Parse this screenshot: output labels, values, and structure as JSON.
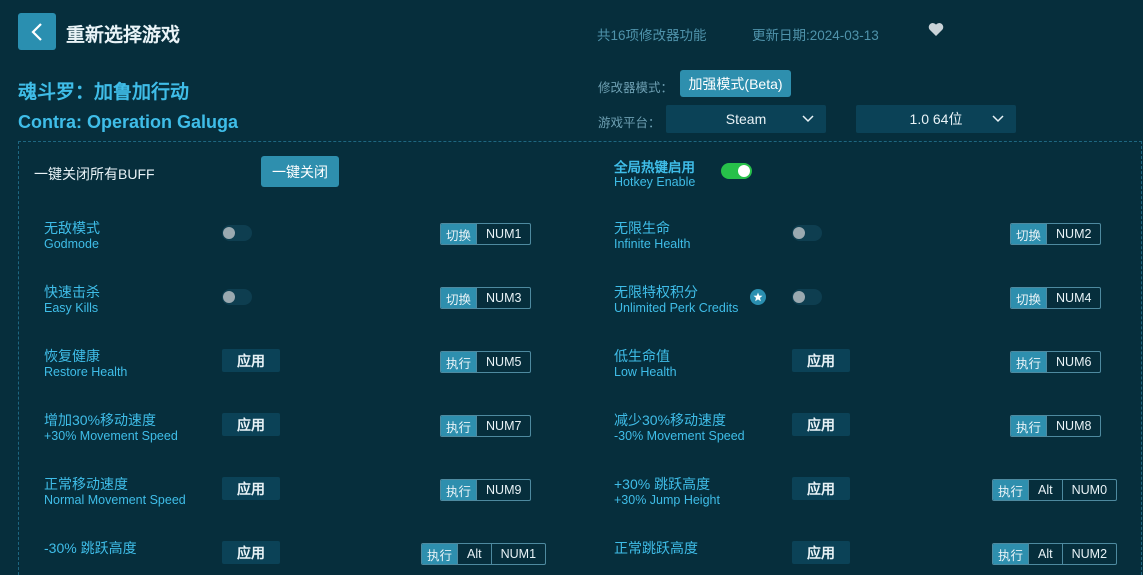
{
  "header": {
    "title": "重新选择游戏",
    "feature_count": "共16项修改器功能",
    "update_date": "更新日期:2024-03-13"
  },
  "game": {
    "name_cn": "魂斗罗：加鲁加行动",
    "name_en": "Contra: Operation Galuga"
  },
  "settings": {
    "mode_label": "修改器模式：",
    "mode_value": "加强模式(Beta)",
    "platform_label": "游戏平台：",
    "platform_value": "Steam",
    "version_value": "1.0 64位"
  },
  "global": {
    "onekey_label": "一键关闭所有BUFF",
    "onekey_button": "一键关闭",
    "hotkey_cn": "全局热键启用",
    "hotkey_en": "Hotkey Enable",
    "hotkey_enabled": true
  },
  "features": [
    {
      "cn": "无敌模式",
      "en": "Godmode",
      "control": "toggle",
      "action": "切换",
      "keys": [
        "NUM1"
      ]
    },
    {
      "cn": "无限生命",
      "en": "Infinite Health",
      "control": "toggle",
      "action": "切换",
      "keys": [
        "NUM2"
      ]
    },
    {
      "cn": "快速击杀",
      "en": "Easy Kills",
      "control": "toggle",
      "action": "切换",
      "keys": [
        "NUM3"
      ]
    },
    {
      "cn": "无限特权积分",
      "en": "Unlimited Perk Credits",
      "control": "toggle",
      "action": "切换",
      "keys": [
        "NUM4"
      ]
    },
    {
      "cn": "恢复健康",
      "en": "Restore Health",
      "control": "apply",
      "apply_label": "应用",
      "action": "执行",
      "keys": [
        "NUM5"
      ]
    },
    {
      "cn": "低生命值",
      "en": "Low Health",
      "control": "apply",
      "apply_label": "应用",
      "action": "执行",
      "keys": [
        "NUM6"
      ]
    },
    {
      "cn": "增加30%移动速度",
      "en": "+30% Movement Speed",
      "control": "apply",
      "apply_label": "应用",
      "action": "执行",
      "keys": [
        "NUM7"
      ]
    },
    {
      "cn": "减少30%移动速度",
      "en": "-30% Movement Speed",
      "control": "apply",
      "apply_label": "应用",
      "action": "执行",
      "keys": [
        "NUM8"
      ]
    },
    {
      "cn": "正常移动速度",
      "en": "Normal Movement Speed",
      "control": "apply",
      "apply_label": "应用",
      "action": "执行",
      "keys": [
        "NUM9"
      ]
    },
    {
      "cn": "+30% 跳跃高度",
      "en": "+30% Jump Height",
      "control": "apply",
      "apply_label": "应用",
      "action": "执行",
      "keys": [
        "Alt",
        "NUM0"
      ]
    },
    {
      "cn": "-30% 跳跃高度",
      "en": "",
      "control": "apply",
      "apply_label": "应用",
      "action": "执行",
      "keys": [
        "Alt",
        "NUM1"
      ]
    },
    {
      "cn": "正常跳跃高度",
      "en": "",
      "control": "apply",
      "apply_label": "应用",
      "action": "执行",
      "keys": [
        "Alt",
        "NUM2"
      ]
    }
  ],
  "colors": {
    "background": "#062e3c",
    "accent": "#2e8fae",
    "label": "#3fbde8",
    "toggle_on": "#27c14a"
  }
}
